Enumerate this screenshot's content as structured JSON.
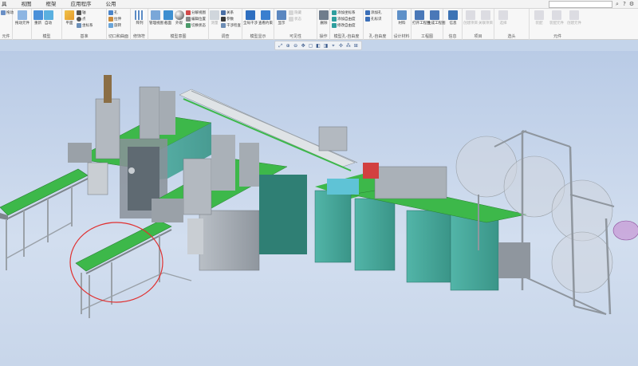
{
  "menubar": {
    "tabs": [
      "具",
      "视图",
      "框架",
      "应用程序",
      "公用"
    ],
    "icons": [
      "search-icon",
      "help-icon",
      "settings-icon",
      "expand-icon"
    ]
  },
  "ribbon": {
    "groups": [
      {
        "label": "元件",
        "buttons": [
          "拖动",
          "拖动元件"
        ]
      },
      {
        "label": "模型",
        "buttons": [
          "重新",
          "自动",
          "放置"
        ]
      },
      {
        "label": "基准",
        "buttons": [
          "平面",
          "轴",
          "点",
          "坐标系"
        ]
      },
      {
        "label": "切口和曲面",
        "buttons": [
          "孔",
          "拉伸",
          "旋转"
        ]
      },
      {
        "label": "修饰符",
        "buttons": [
          "阵列"
        ]
      },
      {
        "label": "模型意图",
        "buttons": [
          "管理视图",
          "截面",
          "外观",
          "分解视图",
          "编辑位置",
          "切换状态"
        ]
      },
      {
        "label": "调查",
        "buttons": [
          "测量",
          "关系",
          "参数",
          "干涉检查"
        ]
      },
      {
        "label": "模型显示",
        "buttons": [
          "全局干涉",
          "查看约束"
        ]
      },
      {
        "label": "可见性",
        "buttons": [
          "显示",
          "隐藏",
          "状态"
        ]
      },
      {
        "label": "操作",
        "buttons": [
          "删除"
        ]
      },
      {
        "label": "模型孔-自由度",
        "buttons": [
          "添加坐标系",
          "添加自由度",
          "修改自由度"
        ]
      },
      {
        "label": "孔-自由度",
        "buttons": [
          "添加孔",
          "孔标识"
        ]
      },
      {
        "label": "设计材料",
        "buttons": [
          "材料"
        ]
      },
      {
        "label": "工程图",
        "buttons": [
          "打开工程图",
          "生成工程图"
        ]
      },
      {
        "label": "信息",
        "buttons": [
          "信息"
        ]
      },
      {
        "label": "项目",
        "buttons": [
          "创建项目",
          "关联项目"
        ]
      },
      {
        "label": "选头",
        "buttons": [
          "选择"
        ]
      },
      {
        "label": "元件",
        "buttons": [
          "装配",
          "装配元件",
          "创建元件"
        ]
      }
    ]
  },
  "gfx_toolbar": {
    "icons": [
      "zoom-fit-icon",
      "zoom-in-icon",
      "zoom-out-icon",
      "pan-icon",
      "view-refresh-icon",
      "saved-views-icon",
      "display-style-icon",
      "datum-display-icon",
      "spin-center-icon",
      "annotations-icon",
      "section-icon"
    ]
  },
  "colors": {
    "conveyor_green": "#3db84a",
    "cabinet_teal": "#3fa89a",
    "frame_gray": "#8f969e",
    "highlight_circle": "#e03030",
    "viewport_bg": "#c4d4ea"
  }
}
